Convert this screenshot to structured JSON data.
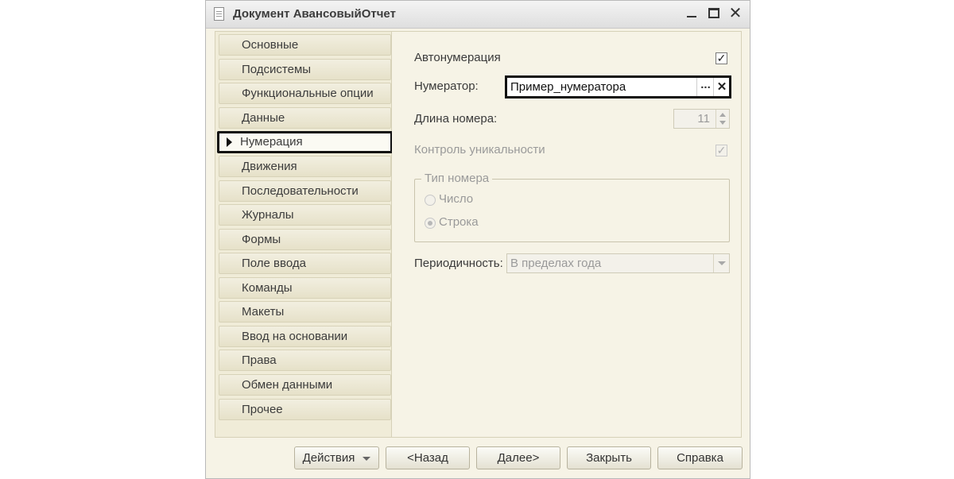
{
  "window": {
    "title": "Документ АвансовыйОтчет",
    "controls": {
      "minimize_icon": "minimize-icon",
      "maximize_icon": "maximize-icon",
      "close_glyph": "✕"
    }
  },
  "sidebar": {
    "items": [
      {
        "label": "Основные"
      },
      {
        "label": "Подсистемы"
      },
      {
        "label": "Функциональные опции"
      },
      {
        "label": "Данные"
      },
      {
        "label": "Нумерация",
        "active": true
      },
      {
        "label": "Движения"
      },
      {
        "label": "Последовательности"
      },
      {
        "label": "Журналы"
      },
      {
        "label": "Формы"
      },
      {
        "label": "Поле ввода"
      },
      {
        "label": "Команды"
      },
      {
        "label": "Макеты"
      },
      {
        "label": "Ввод на основании"
      },
      {
        "label": "Права"
      },
      {
        "label": "Обмен данными"
      },
      {
        "label": "Прочее"
      }
    ]
  },
  "numbering": {
    "autonumbering_label": "Автонумерация",
    "autonumbering_checked": true,
    "numerator_label": "Нумератор:",
    "numerator_value": "Пример_нумератора",
    "numerator_select_glyph": "...",
    "numerator_clear_glyph": "✕",
    "length_label": "Длина номера:",
    "length_value": "11",
    "uniqueness_label": "Контроль уникальности",
    "uniqueness_checked": true,
    "number_type_legend": "Тип номера",
    "number_type_options": [
      "Число",
      "Строка"
    ],
    "number_type_selected": "Строка",
    "periodicity_label": "Периодичность:",
    "periodicity_value": "В пределах года"
  },
  "footer": {
    "actions_label": "Действия",
    "back_label": "<Назад",
    "next_label": "Далее>",
    "close_label": "Закрыть",
    "help_label": "Справка"
  },
  "colors": {
    "panel_background": "#f6f3e6",
    "highlight_border": "#111111",
    "disabled_text": "#9a9a9a"
  }
}
